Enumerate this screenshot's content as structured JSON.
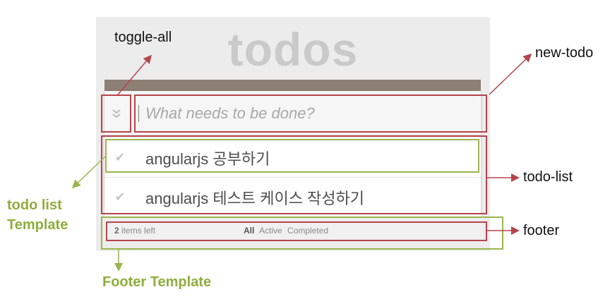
{
  "app": {
    "title": "todos",
    "input_placeholder": "What needs to be done?",
    "toggle_all_icon": "chevron-double-down-icon",
    "todos": [
      {
        "text": "angularjs 공부하기",
        "check_icon": "checkmark-icon"
      },
      {
        "text": "angularjs 테스트 케이스 작성하기",
        "check_icon": "checkmark-icon"
      }
    ],
    "footer": {
      "count": "2",
      "count_suffix": " items left",
      "filters": [
        "All",
        "Active",
        "Completed"
      ],
      "selected_filter": "All"
    }
  },
  "annotations": {
    "toggle_all": "toggle-all",
    "new_todo": "new-todo",
    "todo_list": "todo-list",
    "footer": "footer",
    "todo_list_template_line1": "todo list",
    "todo_list_template_line2": "Template",
    "footer_template": "Footer Template"
  },
  "colors": {
    "red_box": "#b5454c",
    "green_box": "#9bb54e",
    "green_text": "#8fad3d"
  }
}
